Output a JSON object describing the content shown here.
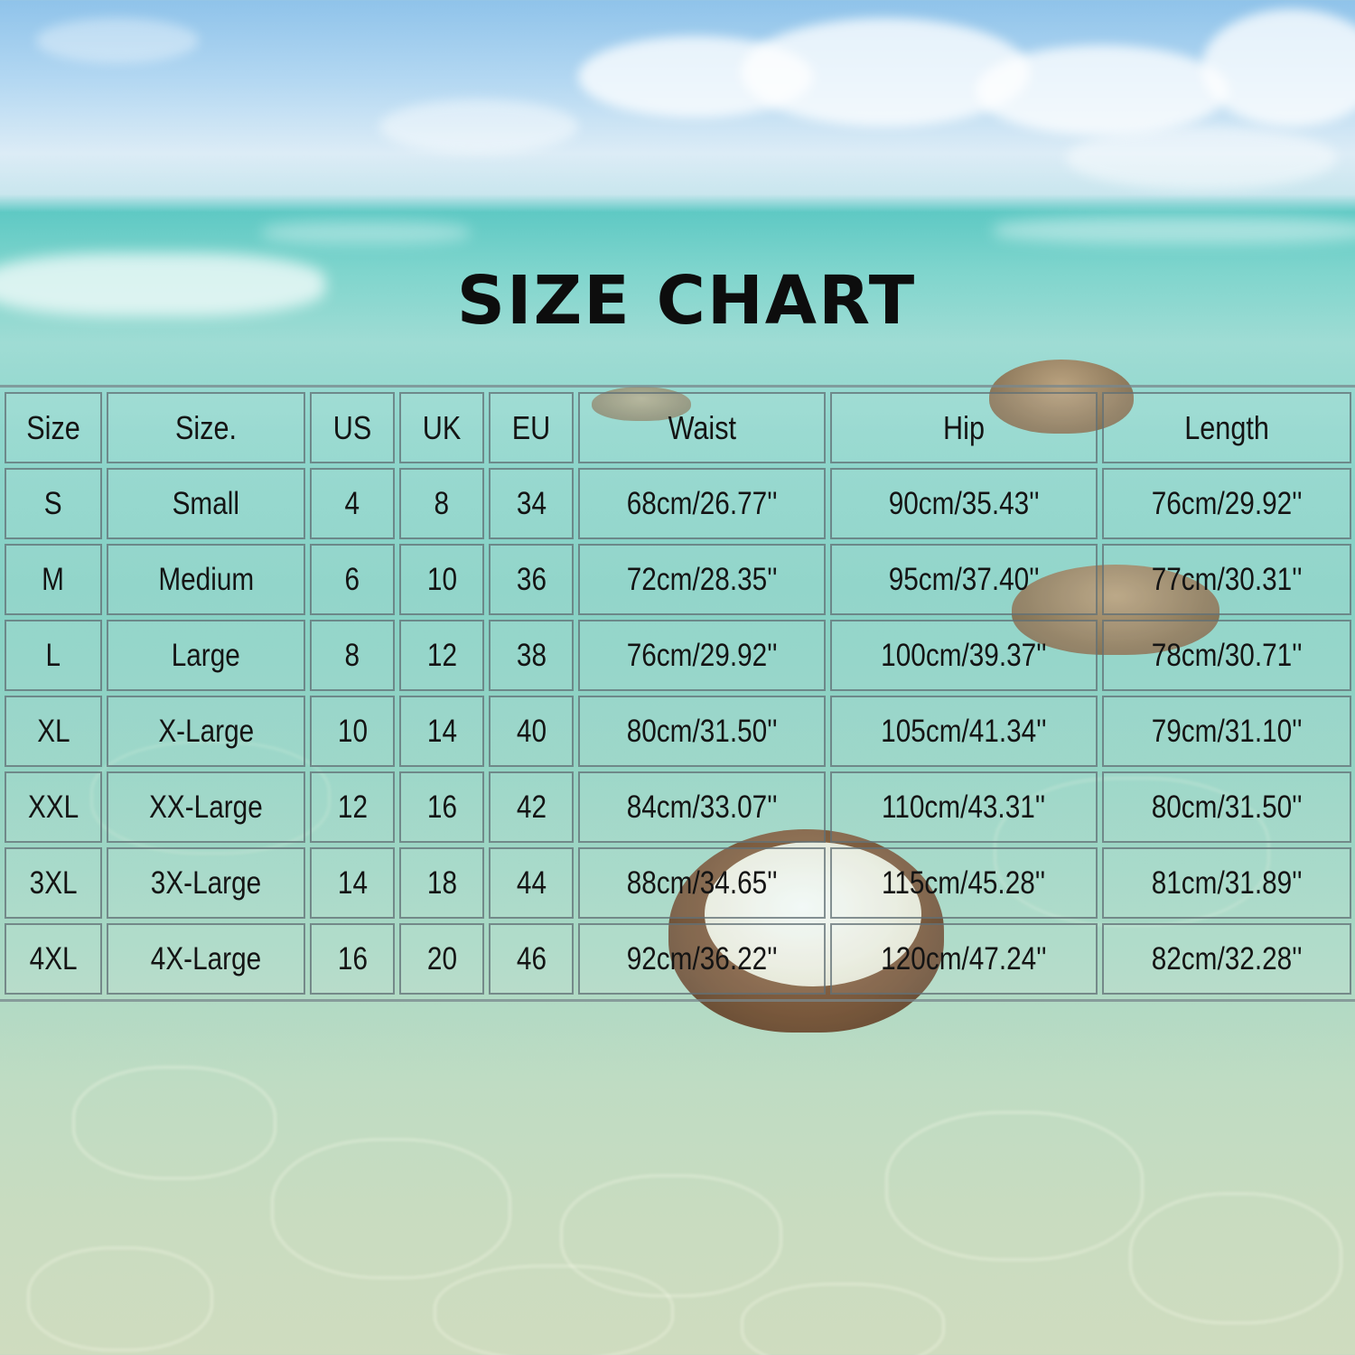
{
  "title": "SIZE CHART",
  "headers": [
    "Size",
    "Size.",
    "US",
    "UK",
    "EU",
    "Waist",
    "Hip",
    "Length"
  ],
  "rows": [
    [
      "S",
      "Small",
      "4",
      "8",
      "34",
      "68cm/26.77''",
      "90cm/35.43''",
      "76cm/29.92''"
    ],
    [
      "M",
      "Medium",
      "6",
      "10",
      "36",
      "72cm/28.35''",
      "95cm/37.40''",
      "77cm/30.31''"
    ],
    [
      "L",
      "Large",
      "8",
      "12",
      "38",
      "76cm/29.92''",
      "100cm/39.37''",
      "78cm/30.71''"
    ],
    [
      "XL",
      "X-Large",
      "10",
      "14",
      "40",
      "80cm/31.50''",
      "105cm/41.34''",
      "79cm/31.10''"
    ],
    [
      "XXL",
      "XX-Large",
      "12",
      "16",
      "42",
      "84cm/33.07''",
      "110cm/43.31''",
      "80cm/31.50''"
    ],
    [
      "3XL",
      "3X-Large",
      "14",
      "18",
      "44",
      "88cm/34.65''",
      "115cm/45.28''",
      "81cm/31.89''"
    ],
    [
      "4XL",
      "4X-Large",
      "16",
      "20",
      "46",
      "92cm/36.22''",
      "120cm/47.24''",
      "82cm/32.28''"
    ]
  ]
}
